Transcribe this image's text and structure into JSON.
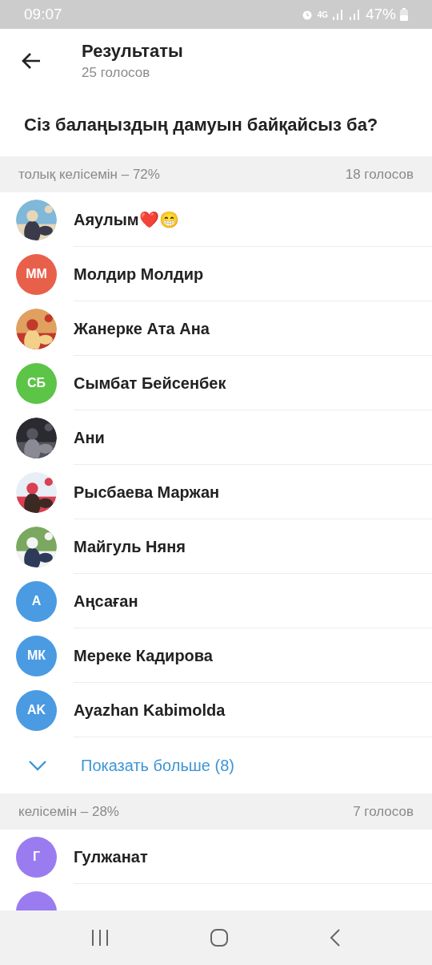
{
  "status_bar": {
    "time": "09:07",
    "network": "4G",
    "battery": "47%"
  },
  "header": {
    "title": "Результаты",
    "subtitle": "25 голосов"
  },
  "question": "Сіз балаңыздың дамуын байқайсыз ба?",
  "sections": [
    {
      "label": "толық келісемін – 72%",
      "count": "18 голосов",
      "voters": [
        {
          "name": "Аяулым❤️😁"
        },
        {
          "name": "Молдир Молдир",
          "avatar": {
            "kind": "initials",
            "initials": "ММ",
            "color": "#e8604a"
          }
        },
        {
          "name": "Жанерке Ата Ана"
        },
        {
          "name": "Сымбат Бейсенбек",
          "avatar": {
            "kind": "initials",
            "initials": "СБ",
            "color": "#5cc447"
          }
        },
        {
          "name": "Ани"
        },
        {
          "name": "Рысбаева Маржан"
        },
        {
          "name": "Майгуль Няня"
        },
        {
          "name": "Аңсаған",
          "avatar": {
            "kind": "initials",
            "initials": "А",
            "color": "#4a9be2"
          }
        },
        {
          "name": "Мереке Кадирова",
          "avatar": {
            "kind": "initials",
            "initials": "МК",
            "color": "#4a9be2"
          }
        },
        {
          "name": "Ayazhan Kabimolda",
          "avatar": {
            "kind": "initials",
            "initials": "AK",
            "color": "#4a9be2"
          }
        }
      ],
      "show_more": "Показать больше (8)"
    },
    {
      "label": "келісемін – 28%",
      "count": "7 голосов",
      "voters": [
        {
          "name": "Гулжанат",
          "avatar": {
            "kind": "initials",
            "initials": "Г",
            "color": "#9a7cf0"
          }
        },
        {
          "avatar": {
            "kind": "initials",
            "color": "#9a7cf0"
          }
        }
      ]
    }
  ]
}
